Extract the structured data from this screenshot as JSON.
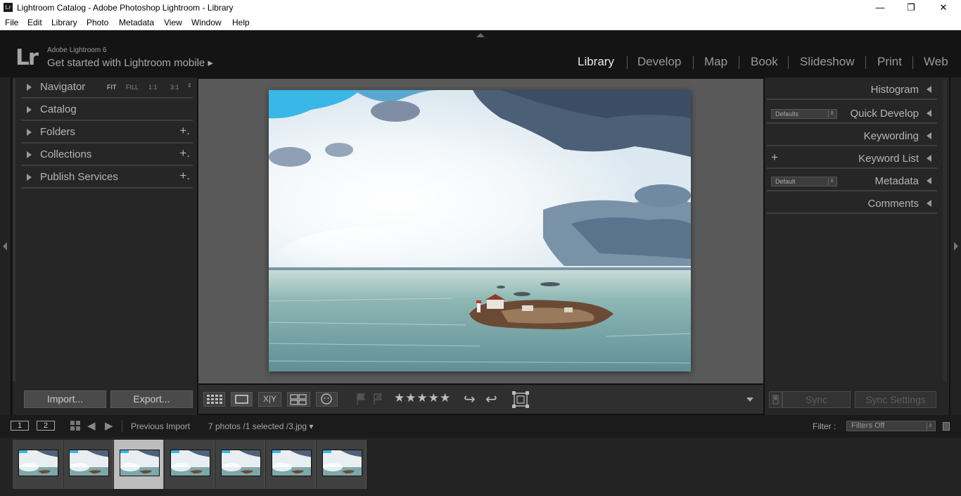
{
  "window": {
    "title": "Lightroom Catalog - Adobe Photoshop Lightroom - Library",
    "minimize": "—",
    "restore": "❐",
    "close": "✕"
  },
  "menu": [
    "File",
    "Edit",
    "Library",
    "Photo",
    "Metadata",
    "View",
    "Window",
    "Help"
  ],
  "identity": {
    "logo": "Lr",
    "version": "Adobe Lightroom 6",
    "mobile": "Get started with Lightroom mobile  ▸"
  },
  "modules": [
    "Library",
    "Develop",
    "Map",
    "Book",
    "Slideshow",
    "Print",
    "Web"
  ],
  "active_module": "Library",
  "left_panel": {
    "navigator": {
      "label": "Navigator",
      "options": [
        "FIT",
        "FILL",
        "1:1",
        "3:1"
      ],
      "active_option": "FIT"
    },
    "sections": [
      {
        "label": "Catalog",
        "plus": ""
      },
      {
        "label": "Folders",
        "plus": "+."
      },
      {
        "label": "Collections",
        "plus": "+."
      },
      {
        "label": "Publish Services",
        "plus": "+."
      }
    ],
    "import_label": "Import...",
    "export_label": "Export..."
  },
  "right_panel": {
    "histogram": "Histogram",
    "quick_develop": {
      "label": "Quick Develop",
      "preset": "Defaults"
    },
    "keywording": "Keywording",
    "keyword_list": {
      "label": "Keyword List",
      "plus": "+"
    },
    "metadata": {
      "label": "Metadata",
      "preset": "Default"
    },
    "comments": "Comments",
    "sync_label": "Sync",
    "sync_settings_label": "Sync Settings"
  },
  "toolbar": {
    "rating_stars": "★★★★★",
    "compare_label": "X|Y",
    "rotate_left": "↩",
    "rotate_right": "↪"
  },
  "filmstrip": {
    "screen1": "1",
    "screen2": "2",
    "source": "Previous Import",
    "status": "7 photos /1 selected /3.jpg ▾",
    "filter_label": "Filter :",
    "filter_value": "Filters Off",
    "thumbnail_count": 7,
    "selected_index": 2
  },
  "colors": {
    "accent": "#e8e8e8",
    "panel": "#262626",
    "canvas": "#595959"
  }
}
